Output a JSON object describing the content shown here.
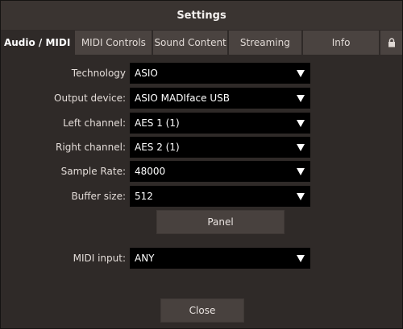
{
  "window": {
    "title": "Settings"
  },
  "tabs": [
    {
      "label": "Audio / MIDI",
      "active": true
    },
    {
      "label": "MIDI Controls"
    },
    {
      "label": "Sound Content"
    },
    {
      "label": "Streaming"
    },
    {
      "label": "Info"
    }
  ],
  "lock_tab": {
    "icon": "lock-icon"
  },
  "fields": {
    "technology": {
      "label": "Technology",
      "value": "ASIO"
    },
    "output_device": {
      "label": "Output device:",
      "value": "ASIO MADIface USB"
    },
    "left_channel": {
      "label": "Left channel:",
      "value": "AES 1 (1)"
    },
    "right_channel": {
      "label": "Right channel:",
      "value": "AES 2 (1)"
    },
    "sample_rate": {
      "label": "Sample Rate:",
      "value": "48000"
    },
    "buffer_size": {
      "label": "Buffer size:",
      "value": "512"
    },
    "midi_input": {
      "label": "MIDI input:",
      "value": "ANY"
    }
  },
  "buttons": {
    "panel": "Panel",
    "close": "Close"
  },
  "colors": {
    "background": "#2f2a28",
    "titlebar": "#3a3431",
    "tab_inactive": "#4a4340",
    "select_bg": "#000000",
    "button": "#48413e"
  }
}
